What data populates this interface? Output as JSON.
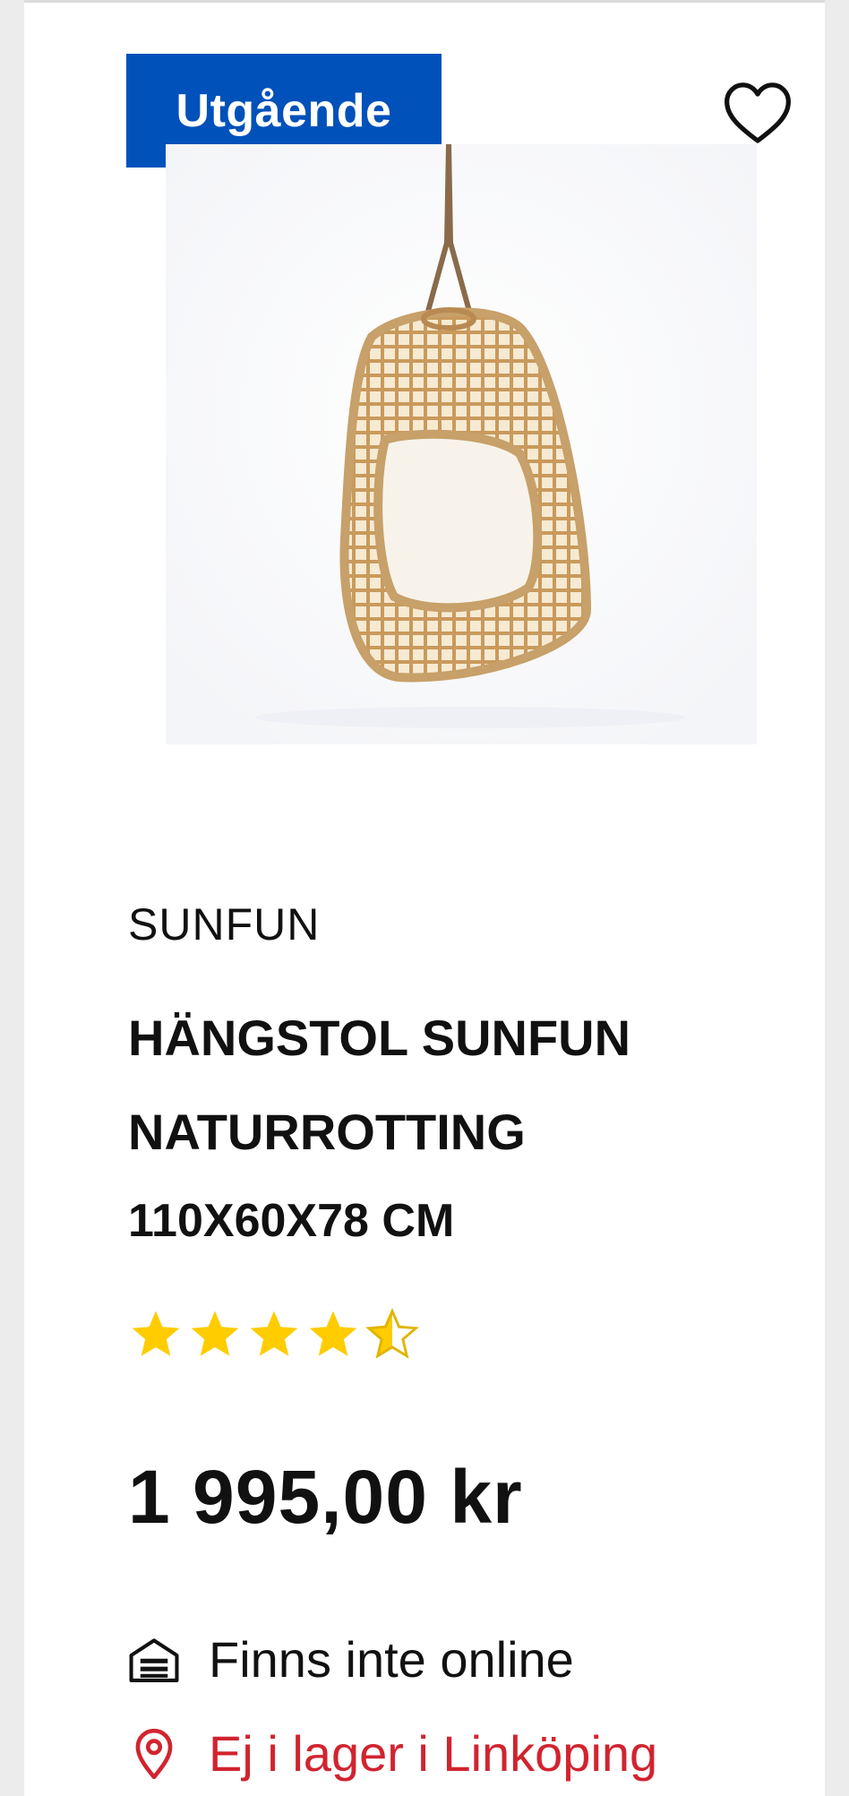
{
  "badge": {
    "label": "Utgående",
    "color": "#0051ba"
  },
  "favorite": {
    "icon": "heart-icon"
  },
  "product": {
    "image_alt": "Hängstol i naturrotting",
    "brand": "SUNFUN",
    "name_line1": "HÄNGSTOL SUNFUN",
    "name_line2": "NATURROTTING",
    "dimensions": "110X60X78 CM",
    "rating": {
      "value": 4.5,
      "max": 5,
      "star_color": "#ffcc00"
    },
    "price": "1 995,00 kr"
  },
  "availability": {
    "online": {
      "icon": "truck-icon",
      "text": "Finns inte online"
    },
    "store": {
      "icon": "location-pin-icon",
      "text": "Ej i lager i Linköping",
      "color": "#d1242f"
    }
  }
}
